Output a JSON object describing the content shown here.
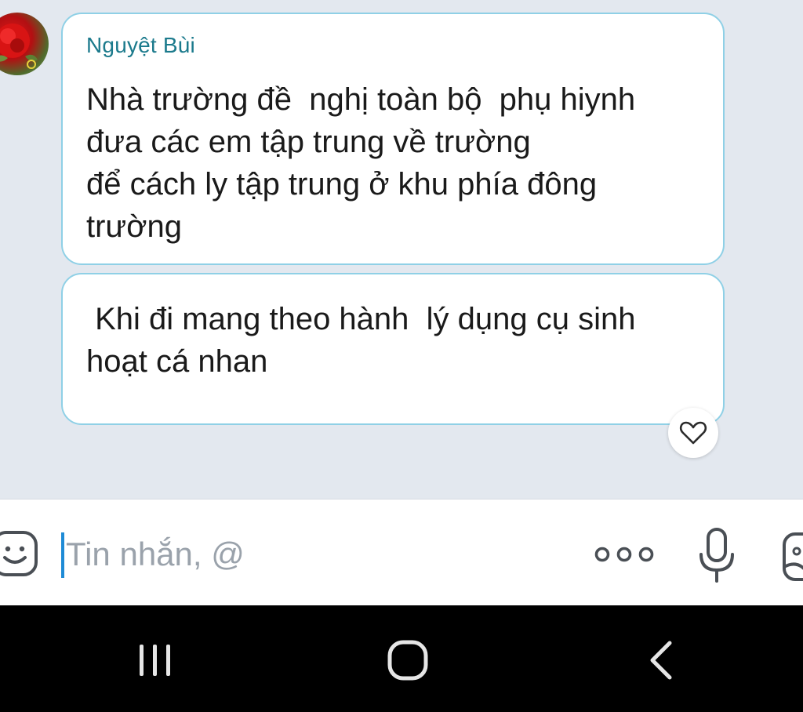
{
  "conversation": {
    "messages": [
      {
        "sender": "Nguyệt Bùi",
        "text": "Nhà trường đề  nghị toàn bộ  phụ hiynh\nđưa các em tập trung về trường\nđể cách ly tập trung ở khu phía đông\ntrường"
      },
      {
        "text": " Khi đi mang theo hành  lý dụng cụ sinh\nhoạt cá nhan"
      }
    ],
    "reaction_icon": "heart-outline-icon"
  },
  "composer": {
    "placeholder": "Tin nhắn, @",
    "value": "",
    "icons": {
      "emoji": "smiley-icon",
      "more": "more-dots-icon",
      "mic": "microphone-icon",
      "sticker": "sticker-icon"
    }
  },
  "navigation": {
    "icons": [
      "recent-apps-icon",
      "home-icon",
      "back-icon"
    ]
  },
  "colors": {
    "chat_background": "#e3e8ef",
    "bubble_border": "#8fd0e6",
    "sender_name": "#1b7a8c",
    "cursor": "#1e8bd6",
    "nav_background": "#000000"
  }
}
